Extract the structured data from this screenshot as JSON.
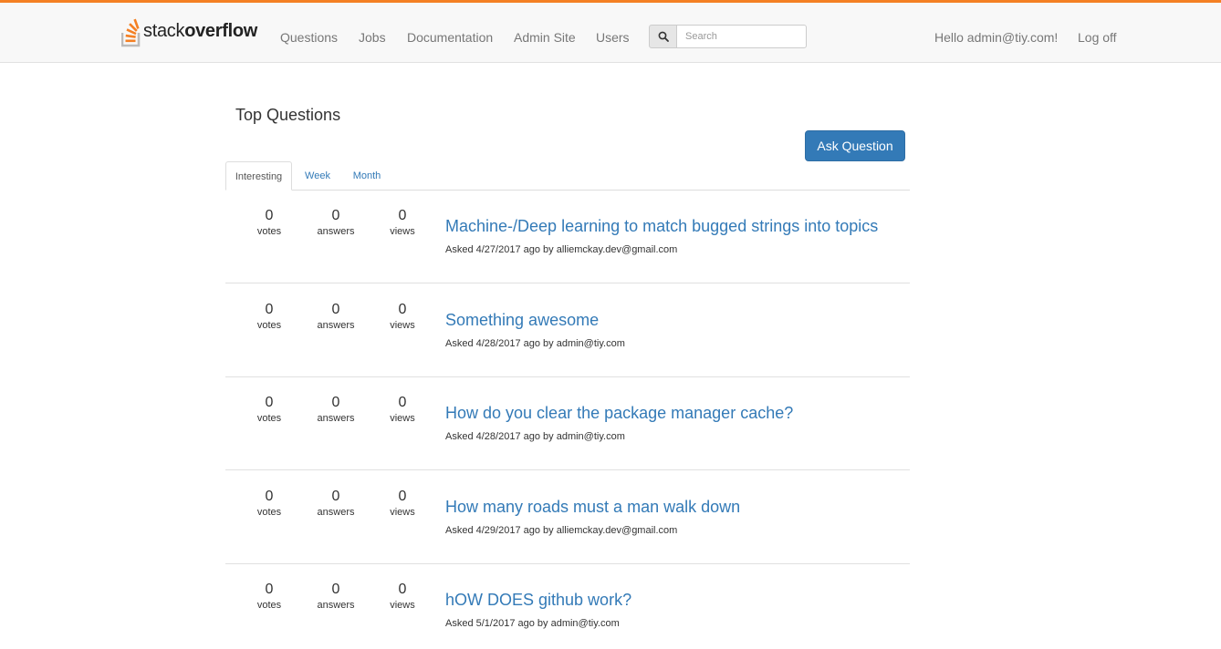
{
  "header": {
    "brand": {
      "light": "stack",
      "bold": "overflow"
    },
    "nav": [
      "Questions",
      "Jobs",
      "Documentation",
      "Admin Site",
      "Users"
    ],
    "search": {
      "placeholder": "Search",
      "icon": "search-icon"
    },
    "greeting": "Hello admin@tiy.com!",
    "logoff": "Log off",
    "colors": {
      "accent": "#f48024",
      "link": "#337ab7"
    }
  },
  "main": {
    "title": "Top Questions",
    "ask_button": "Ask Question",
    "tabs": [
      "Interesting",
      "Week",
      "Month"
    ],
    "active_tab": "Interesting",
    "stat_labels": {
      "votes": "votes",
      "answers": "answers",
      "views": "views"
    },
    "questions": [
      {
        "votes": "0",
        "answers": "0",
        "views": "0",
        "title": "Machine-/Deep learning to match bugged strings into topics",
        "meta": "Asked 4/27/2017 ago by alliemckay.dev@gmail.com"
      },
      {
        "votes": "0",
        "answers": "0",
        "views": "0",
        "title": "Something awesome",
        "meta": "Asked 4/28/2017 ago by admin@tiy.com"
      },
      {
        "votes": "0",
        "answers": "0",
        "views": "0",
        "title": "How do you clear the package manager cache?",
        "meta": "Asked 4/28/2017 ago by admin@tiy.com"
      },
      {
        "votes": "0",
        "answers": "0",
        "views": "0",
        "title": "How many roads must a man walk down",
        "meta": "Asked 4/29/2017 ago by alliemckay.dev@gmail.com"
      },
      {
        "votes": "0",
        "answers": "0",
        "views": "0",
        "title": "hOW DOES github work?",
        "meta": "Asked 5/1/2017 ago by admin@tiy.com"
      }
    ]
  }
}
